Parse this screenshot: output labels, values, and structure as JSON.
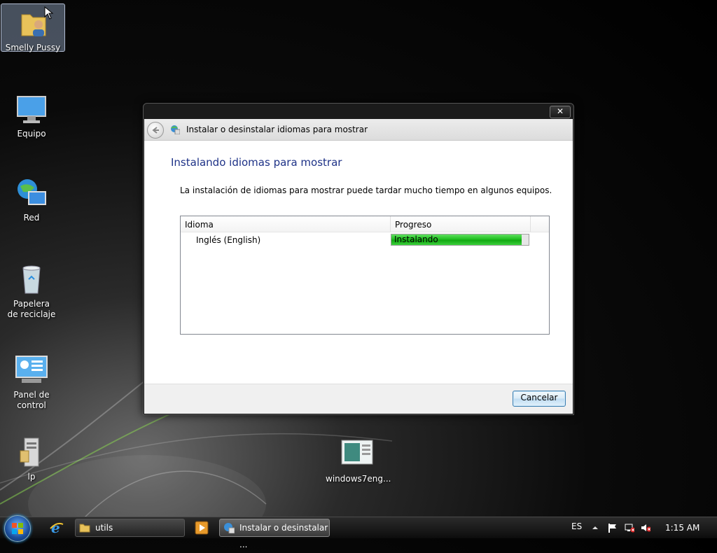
{
  "desktop": {
    "icons": [
      {
        "label": "Smelly Pussy"
      },
      {
        "label": "Equipo"
      },
      {
        "label": "Red"
      },
      {
        "label": "Papelera de reciclaje"
      },
      {
        "label": "Panel de control"
      },
      {
        "label": "lp"
      },
      {
        "label": "windows7eng..."
      }
    ]
  },
  "dialog": {
    "close_label": "✕",
    "nav_title": "Instalar o desinstalar idiomas para mostrar",
    "heading": "Instalando idiomas para mostrar",
    "description": "La instalación de idiomas para mostrar puede tardar mucho tiempo en algunos equipos.",
    "table": {
      "columns": [
        "Idioma",
        "Progreso"
      ],
      "rows": [
        {
          "language": "Inglés (English)",
          "status": "Instalando",
          "progress_fraction": 0.95
        }
      ]
    },
    "cancel_label": "Cancelar"
  },
  "taskbar": {
    "buttons": [
      {
        "label": "utils"
      },
      {
        "label": "Instalar o desinstalar ..."
      }
    ],
    "language": "ES",
    "clock": "1:15 AM"
  },
  "colors": {
    "heading": "#1e3287",
    "progress": "#20c020",
    "button_border": "#3c7fb1"
  }
}
